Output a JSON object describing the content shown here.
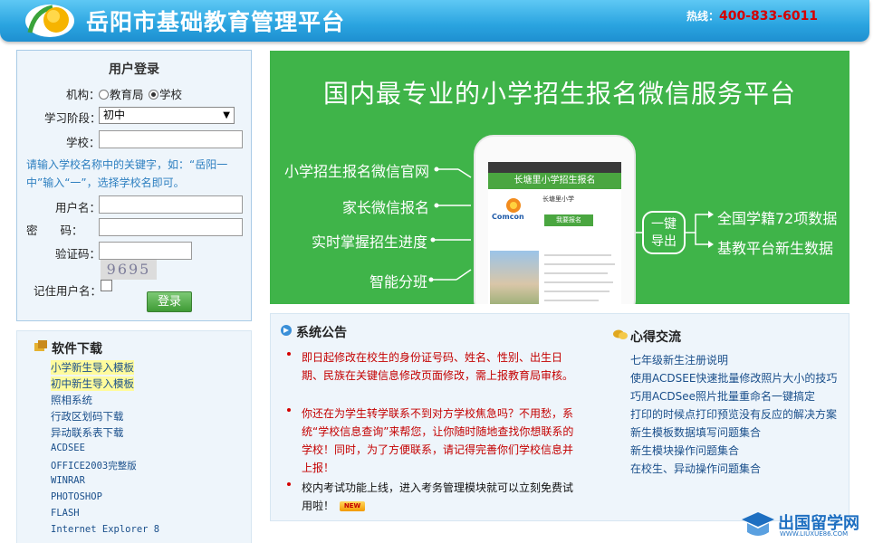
{
  "header": {
    "title": "岳阳市基础教育管理平台",
    "hotline_label": "热线：",
    "hotline_number": "400-833-6011"
  },
  "login": {
    "title": "用户登录",
    "org_label": "机构：",
    "org_options": [
      "教育局",
      "学校"
    ],
    "org_selected": "学校",
    "stage_label": "学习阶段：",
    "stage_value": "初中",
    "school_label": "学校：",
    "school_hint": "请输入学校名称中的关键字，如：“岳阳一中”输入“一”，选择学校名即可。",
    "username_label": "用户名：",
    "password_label": "密　　码：",
    "captcha_label": "验证码：",
    "captcha_value": "9695",
    "remember_label": "记住用户名：",
    "login_button": "登录"
  },
  "downloads": {
    "title": "软件下载",
    "items": [
      "小学新生导入模板",
      "初中新生导入模板",
      "照相系统",
      "行政区划码下载",
      "异动联系表下载",
      "ACDSEE",
      "OFFICE2003完整版",
      "WINRAR",
      "PHOTOSHOP",
      "FLASH",
      "Internet Explorer 8"
    ]
  },
  "banner": {
    "headline": "国内最专业的小学招生报名微信服务平台",
    "features": [
      "小学招生报名微信官网",
      "家长微信报名",
      "实时掌握招生进度",
      "智能分班"
    ],
    "phone_title": "长塘里小学招生报名",
    "phone_school": "长塘里小学",
    "phone_button": "我要报名",
    "phone_logo": "Comcon",
    "onekey_line1": "一键",
    "onekey_line2": "导出",
    "right_items": [
      "全国学籍72项数据",
      "基教平台新生数据"
    ]
  },
  "notices": {
    "title": "系统公告",
    "items": [
      "即日起修改在校生的身份证号码、姓名、性别、出生日期、民族在关键信息修改页面修改，需上报教育局审核。",
      "你还在为学生转学联系不到对方学校焦急吗？不用愁，系统“学校信息查询”来帮您，让你随时随地查找你想联系的学校！同时，为了方便联系，请记得完善你们学校信息并上报！",
      "校内考试功能上线，进入考务管理模块就可以立刻免费试用啦！"
    ],
    "new_badge": "NEW"
  },
  "experience": {
    "title": "心得交流",
    "items": [
      "七年级新生注册说明",
      "使用ACDSEE快速批量修改照片大小的技巧",
      "巧用ACDSee照片批量重命名一键搞定",
      "打印的时候点打印预览没有反应的解决方案",
      "新生模板数据填写问题集合",
      "新生模块操作问题集合",
      "在校生、异动操作问题集合"
    ]
  },
  "watermark": {
    "text": "出国留学网",
    "url": "WWW.LIUXUE86.COM"
  },
  "colors": {
    "header_blue": "#2aa4e0",
    "banner_green": "#3fb449",
    "notice_red": "#c40000",
    "link_blue": "#1a4f8b"
  }
}
